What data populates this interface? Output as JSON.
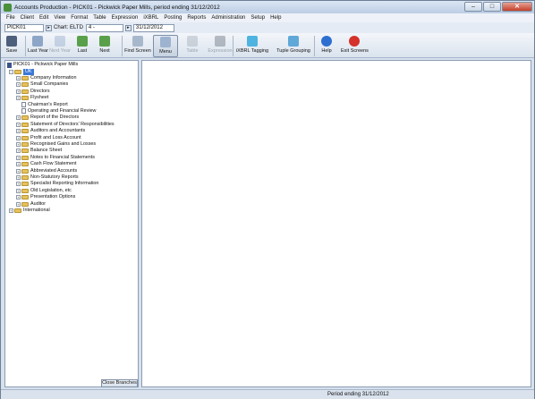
{
  "window": {
    "title": "Accounts Production - PICK01 - Pickwick Paper Mills, period ending 31/12/2012"
  },
  "menu": [
    "File",
    "Client",
    "Edit",
    "View",
    "Format",
    "Table",
    "Expression",
    "iXBRL",
    "Posting",
    "Reports",
    "Administration",
    "Setup",
    "Help"
  ],
  "selector": {
    "client_code": "PICK01",
    "chart_label": "Chart: ELTD",
    "chart_value": "4 -",
    "period_end": "31/12/2012"
  },
  "toolbar": [
    {
      "label": "Save",
      "icon": "save-icon",
      "enabled": true
    },
    {
      "label": "Last Year",
      "icon": "calendar-icon",
      "enabled": true
    },
    {
      "label": "Next Year",
      "icon": "calendar-icon",
      "enabled": false
    },
    {
      "label": "Last",
      "icon": "last-arrow-icon",
      "enabled": true
    },
    {
      "label": "Next",
      "icon": "next-arrow-icon",
      "enabled": true
    },
    {
      "label": "Find Screen",
      "icon": "magnifier-icon",
      "enabled": true
    },
    {
      "label": "Menu",
      "icon": "menu-icon",
      "enabled": true,
      "active": true
    },
    {
      "label": "Table",
      "icon": "table-icon",
      "enabled": false
    },
    {
      "label": "Expression",
      "icon": "expression-icon",
      "enabled": false
    },
    {
      "label": "iXBRL Tagging",
      "icon": "tag-icon",
      "enabled": true
    },
    {
      "label": "Tuple Grouping",
      "icon": "tuple-icon",
      "enabled": true
    },
    {
      "label": "Help",
      "icon": "help-icon",
      "enabled": true
    },
    {
      "label": "Exit Screens",
      "icon": "exit-icon",
      "enabled": true
    }
  ],
  "tree": {
    "root": "PICK01 - Pickwick Paper Mills",
    "uk_label": "UK",
    "children": [
      {
        "label": "Company Information",
        "type": "folder"
      },
      {
        "label": "Small Companies",
        "type": "folder"
      },
      {
        "label": "Directors",
        "type": "folder"
      },
      {
        "label": "Flysheet",
        "type": "folder"
      },
      {
        "label": "Chairman's Report",
        "type": "doc"
      },
      {
        "label": "Operating and Financial Review",
        "type": "doc"
      },
      {
        "label": "Report of the Directors",
        "type": "folder"
      },
      {
        "label": "Statement of Directors' Responsibilities",
        "type": "folder"
      },
      {
        "label": "Auditors and Accountants",
        "type": "folder"
      },
      {
        "label": "Profit and Loss Account",
        "type": "folder"
      },
      {
        "label": "Recognised Gains and Losses",
        "type": "folder"
      },
      {
        "label": "Balance Sheet",
        "type": "folder"
      },
      {
        "label": "Notes to Financial Statements",
        "type": "folder"
      },
      {
        "label": "Cash Flow Statement",
        "type": "folder"
      },
      {
        "label": "Abbreviated Accounts",
        "type": "folder"
      },
      {
        "label": "Non-Statutory Reports",
        "type": "folder"
      },
      {
        "label": "Specialist Reporting Information",
        "type": "folder"
      },
      {
        "label": "Old Legislation, etc",
        "type": "folder"
      },
      {
        "label": "Presentation Options",
        "type": "folder"
      },
      {
        "label": "Auditor",
        "type": "folder"
      }
    ],
    "international": "International",
    "close_branches": "Close Branches"
  },
  "status": {
    "text": "Period ending 31/12/2012"
  }
}
